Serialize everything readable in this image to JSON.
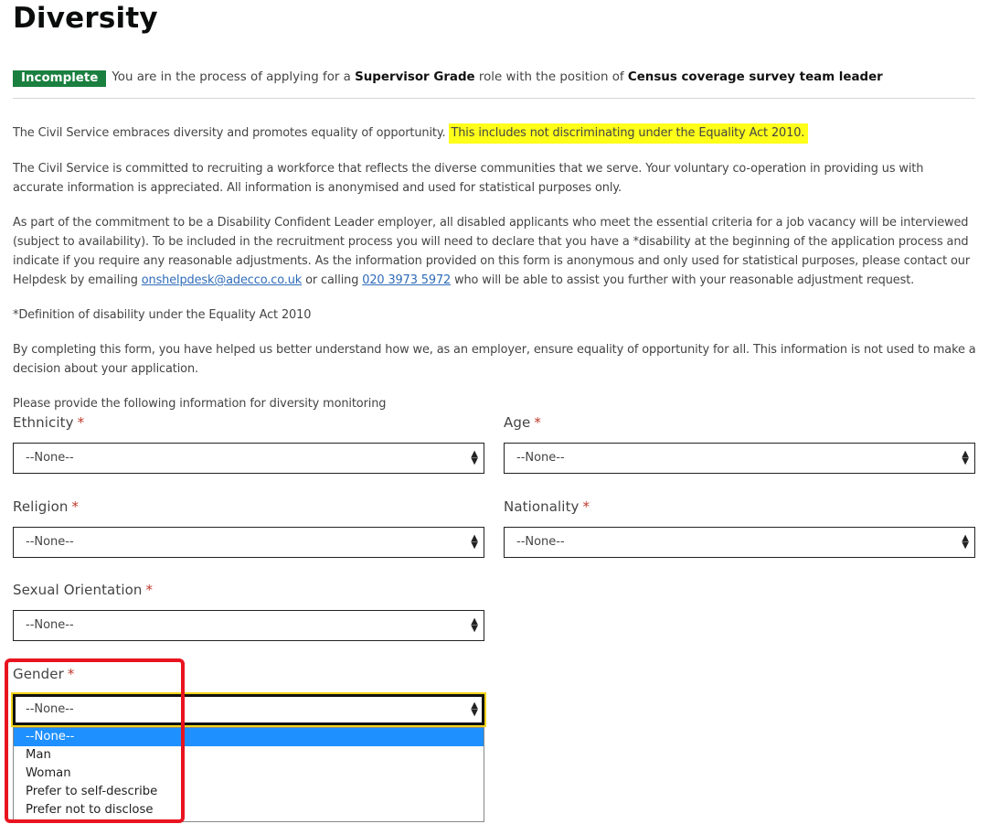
{
  "page_title": "Diversity",
  "status": {
    "badge": "Incomplete",
    "text_1": "You are in the process of applying for a ",
    "grade": "Supervisor Grade",
    "text_2": " role with the position of ",
    "position": "Census coverage survey team leader"
  },
  "intro": {
    "p1_start": "The Civil Service embraces diversity and promotes equality of opportunity.",
    "p1_highlight": "This includes not discriminating under the Equality Act 2010.",
    "p2": "The Civil Service is committed to recruiting a workforce that reflects the diverse communities that we serve. Your voluntary co-operation in providing us with accurate information is appreciated. All information is anonymised and used for statistical purposes only.",
    "p3_start": "As part of the commitment to be a Disability Confident Leader employer, all disabled applicants who meet the essential criteria for a job vacancy will be interviewed (subject to availability). To be included in the recruitment process you will need to declare that you have a *disability at the beginning of the application process and indicate if you require any reasonable adjustments. As the information provided on this form is anonymous and only used for statistical purposes, please contact our Helpdesk by emailing ",
    "p3_email": "onshelpdesk@adecco.co.uk",
    "p3_mid": " or calling ",
    "p3_phone": "020 3973 5972",
    "p3_end": " who will be able to assist you further with your reasonable adjustment request.",
    "p4": "*Definition of disability under the Equality Act 2010",
    "p5": "By completing this form, you have helped us better understand how we, as an employer, ensure equality of opportunity for all. This information is not used to make a decision about your application.",
    "p6": "Please provide the following information for diversity monitoring"
  },
  "fields": {
    "ethnicity": {
      "label": "Ethnicity",
      "value": "--None--"
    },
    "age": {
      "label": "Age",
      "value": "--None--"
    },
    "religion": {
      "label": "Religion",
      "value": "--None--"
    },
    "nationality": {
      "label": "Nationality",
      "value": "--None--"
    },
    "sexual_orientation": {
      "label": "Sexual Orientation",
      "value": "--None--"
    },
    "gender": {
      "label": "Gender",
      "value": "--None--"
    },
    "required_mark": "*"
  },
  "gender_options": [
    "--None--",
    "Man",
    "Woman",
    "Prefer to self-describe",
    "Prefer not to disclose"
  ],
  "colors": {
    "badge": "#1a7f3f",
    "highlight": "#ffff1a",
    "link": "#2e6bb8",
    "required": "#c0392b",
    "selected_option": "#1e90ff",
    "annotation_box": "#e8141f"
  }
}
